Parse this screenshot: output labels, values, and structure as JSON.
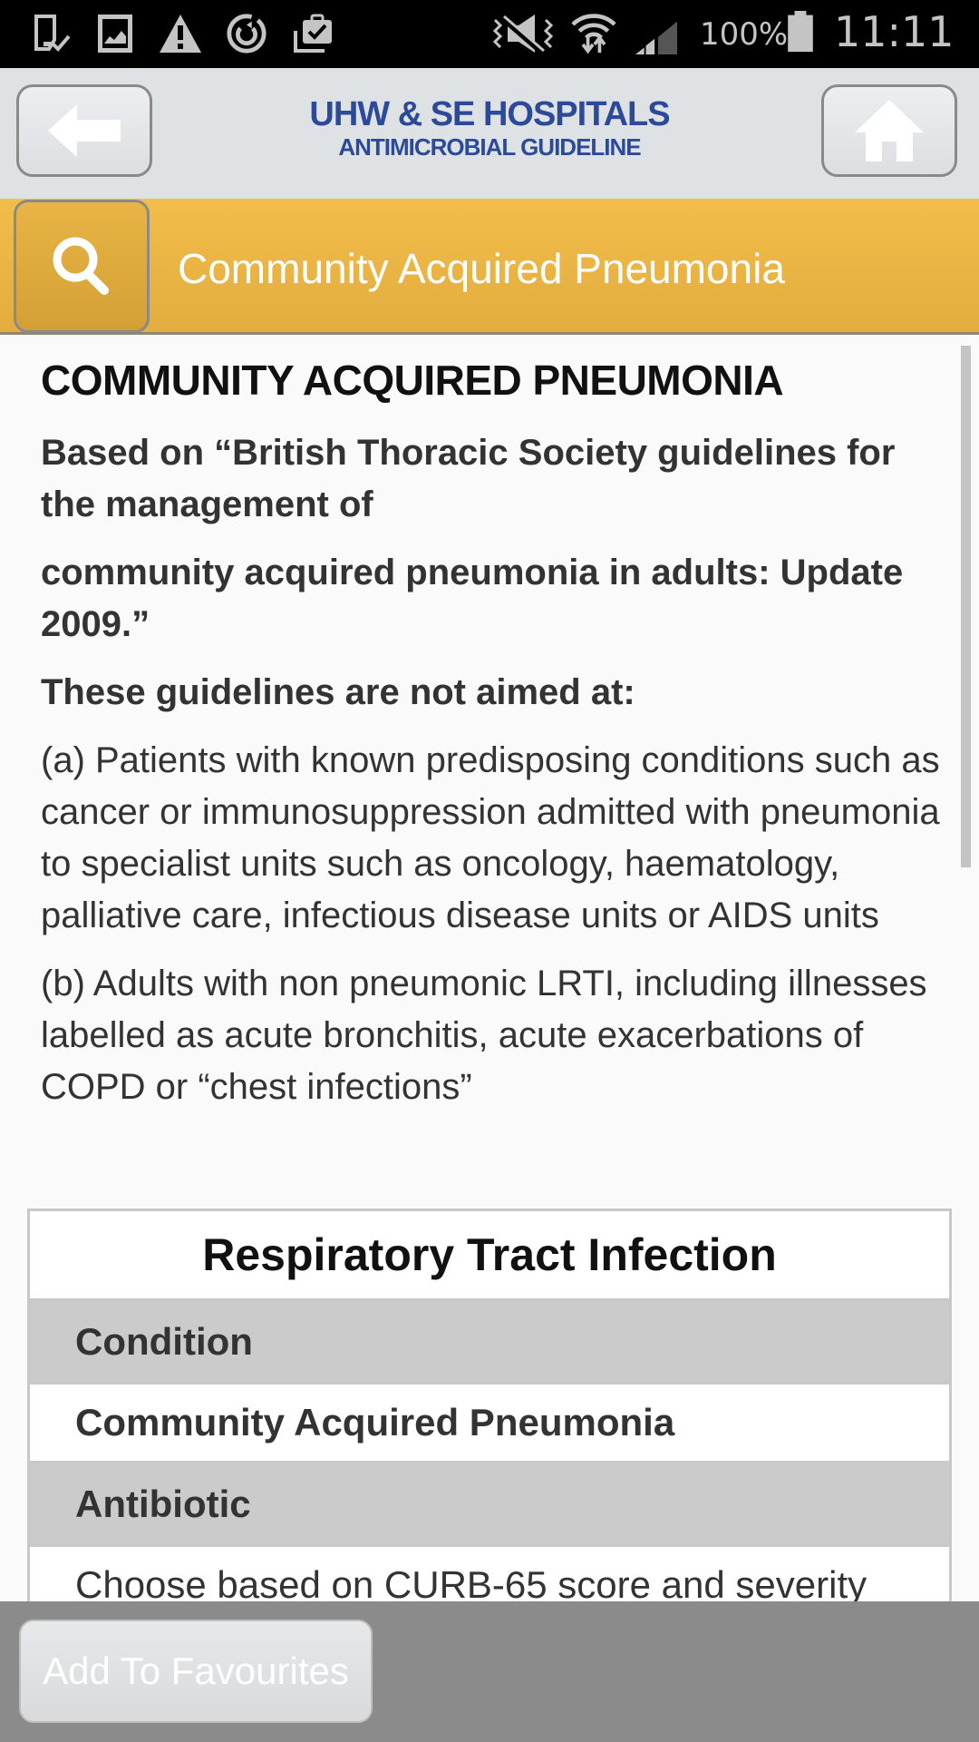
{
  "status_bar": {
    "left_icons": [
      "screenshot-saved-icon",
      "image-icon",
      "warning-icon",
      "sync-icon",
      "briefcase-check-icon"
    ],
    "right_icons": [
      "vibrate-mute-icon",
      "wifi-icon",
      "signal-icon",
      "battery-icon"
    ],
    "battery": "100%",
    "time": "11:11"
  },
  "header": {
    "back_icon": "arrow-left-icon",
    "home_icon": "home-icon",
    "brand_line1": "UHW & SE HOSPITALS",
    "brand_line2": "ANTIMICROBIAL GUIDELINE",
    "brand_color": "#2c4a9a"
  },
  "search_bar": {
    "icon": "search-icon",
    "title": "Community Acquired Pneumonia",
    "accent_color": "#f0b847"
  },
  "content": {
    "heading": "COMMUNITY ACQUIRED PNEUMONIA",
    "intro_1": "Based on “British Thoracic Society guidelines for the management of",
    "intro_2": "community acquired pneumonia in adults: Update 2009.”",
    "not_aimed": "These guidelines are not aimed at:",
    "item_a": "(a) Patients with known predisposing conditions such as cancer or immunosuppression admitted with pneumonia to specialist units such as oncology, haematology, palliative care, infectious disease units or AIDS units",
    "item_b": "(b) Adults with non pneumonic LRTI, including illnesses labelled as acute bronchitis, acute exacerbations of COPD or “chest infections”"
  },
  "table": {
    "title": "Respiratory Tract Infection",
    "rows": [
      {
        "label": "Condition",
        "type": "head"
      },
      {
        "label": "Community Acquired Pneumonia",
        "type": "val"
      },
      {
        "label": "Antibiotic",
        "type": "head"
      },
      {
        "label": "Choose based on CURB-65 score and severity",
        "type": "plain"
      }
    ]
  },
  "footer": {
    "add_favourites": "Add To Favourites"
  }
}
